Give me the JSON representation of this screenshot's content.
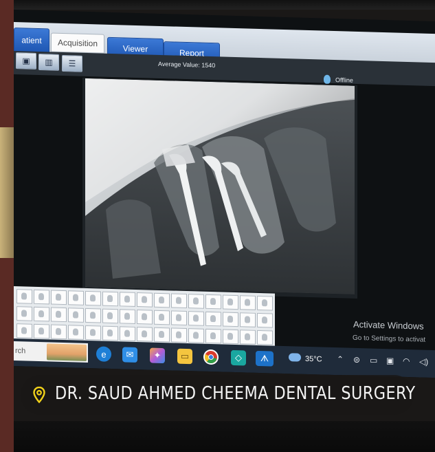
{
  "tabs": [
    {
      "label": "atient",
      "active": false
    },
    {
      "label": "Acquisition",
      "active": true
    },
    {
      "label": "Viewer",
      "active": false
    },
    {
      "label": "Report",
      "active": false
    }
  ],
  "toolbar": {
    "tools": [
      "camera-icon",
      "split-view-icon",
      "scanner-icon"
    ],
    "average_label": "Average Value:",
    "average_value": "1540",
    "status": "Offline"
  },
  "thumbnails": {
    "rows": 3,
    "columns": 15
  },
  "watermark": {
    "title": "Activate Windows",
    "subtitle": "Go to Settings to activat"
  },
  "taskbar": {
    "search_text": "rch",
    "apps": [
      "edge-icon",
      "mail-icon",
      "copilot-icon",
      "file-explorer-icon",
      "chrome-icon",
      "store-icon",
      "dental-app-icon"
    ],
    "temperature": "35°C",
    "tray": [
      "chevron-up-icon",
      "network-icon",
      "battery-icon",
      "display-icon",
      "wifi-icon",
      "volume-icon"
    ]
  },
  "caption": {
    "text": "DR. SAUD AHMED CHEEMA DENTAL SURGERY",
    "icon": "location-pin-icon"
  },
  "colors": {
    "tab_blue": "#2a66c4",
    "taskbar": "#1f2b3a",
    "accent_pin": "#f2d21a"
  }
}
